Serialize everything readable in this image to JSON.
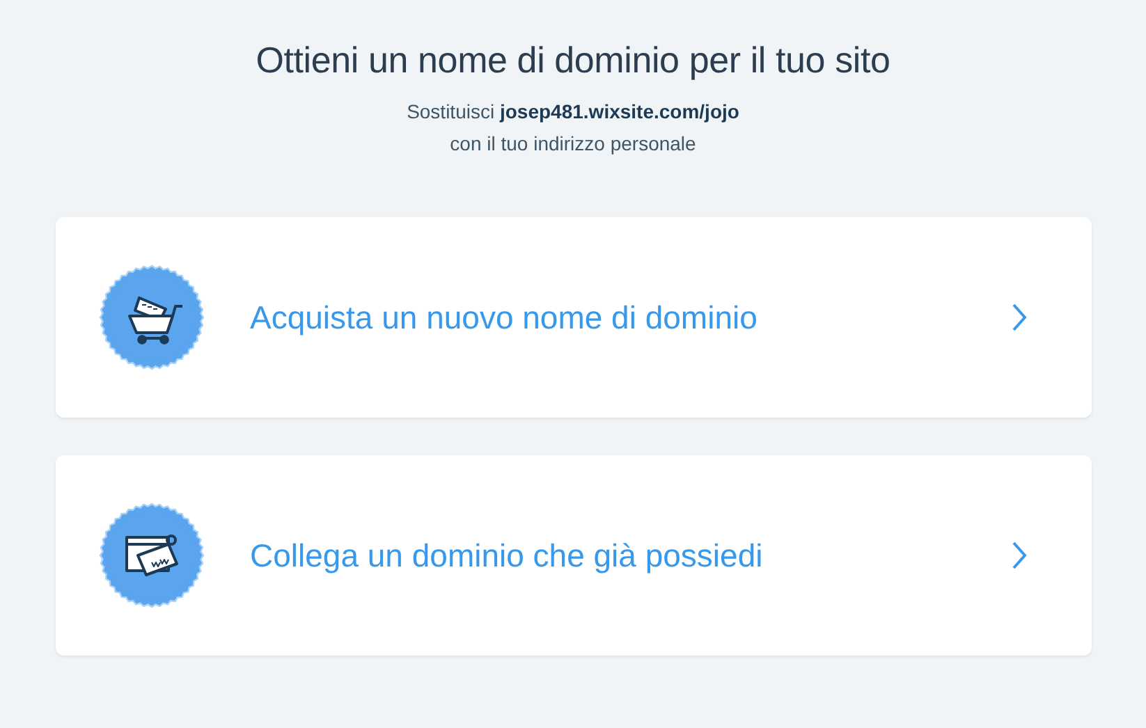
{
  "title": "Ottieni un nome di dominio per il tuo sito",
  "subtitle_lines": [
    "Sostituisci **josep481.wixsite.com/jojo**",
    "con il tuo indirizzo personale"
  ],
  "options": [
    {
      "kind": "cart",
      "label": "Acquista un nuovo nome di dominio"
    },
    {
      "kind": "connect",
      "label": "Collega un dominio che già possiedi"
    }
  ]
}
